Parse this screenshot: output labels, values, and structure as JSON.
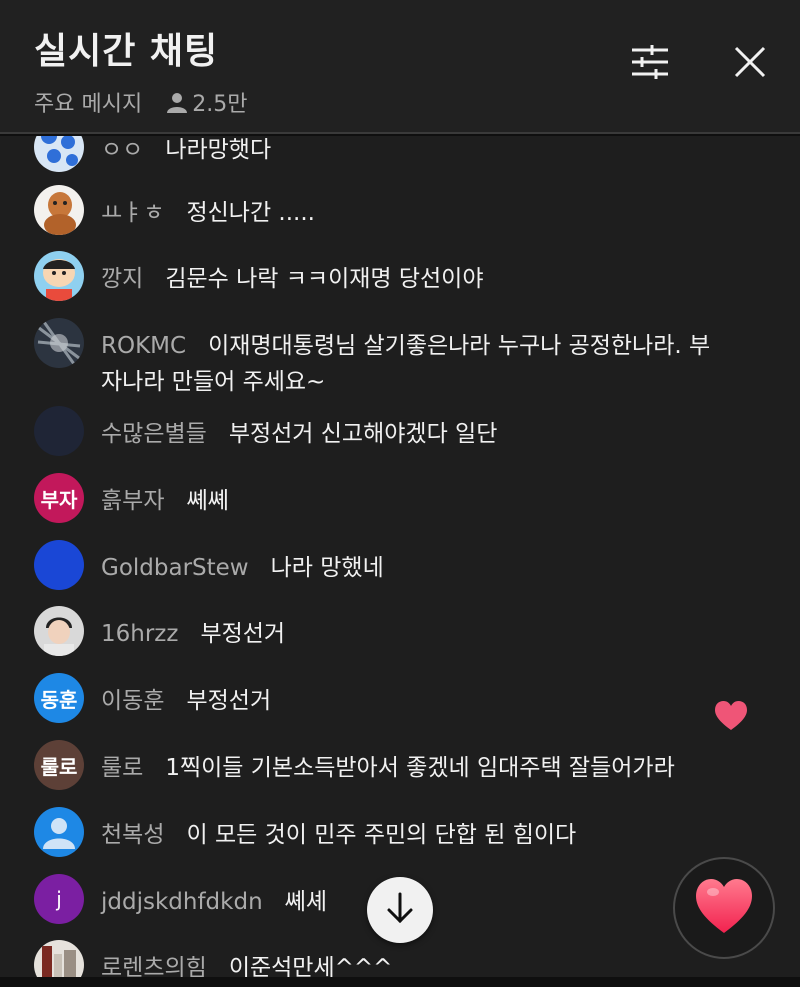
{
  "header": {
    "title": "실시간 채팅",
    "mode_label": "주요 메시지",
    "viewer_count": "2.5만",
    "filter_icon": "sliders-icon",
    "close_icon": "close-icon"
  },
  "messages": [
    {
      "author": "ㅇㅇ",
      "text": "나라망햇다",
      "avatar_text": ""
    },
    {
      "author": "ㅛㅑㅎ",
      "text": "정신나간 .....",
      "avatar_text": ""
    },
    {
      "author": "깡지",
      "text": "김문수 나락 ㅋㅋ이재명 당선이야",
      "avatar_text": ""
    },
    {
      "author": "ROKMC",
      "text": "이재명대통령님 살기좋은나라 누구나 공정한나라. 부자나라 만들어 주세요~",
      "avatar_text": ""
    },
    {
      "author": "수많은별들",
      "text": "부정선거 신고해야겠다 일단",
      "avatar_text": ""
    },
    {
      "author": "흙부자",
      "text": "쎼쎼",
      "avatar_text": "부자"
    },
    {
      "author": "GoldbarStew",
      "text": "나라 망했네",
      "avatar_text": ""
    },
    {
      "author": "16hrzz",
      "text": "부정선거",
      "avatar_text": ""
    },
    {
      "author": "이동훈",
      "text": "부정선거",
      "avatar_text": "동훈"
    },
    {
      "author": "룰로",
      "text": "1찍이들 기본소득받아서 좋겠네 임대주택 잘들어가라",
      "avatar_text": "룰로"
    },
    {
      "author": "천복성",
      "text": "이 모든 것이 민주 주민의 단합 된 힘이다",
      "avatar_text": ""
    },
    {
      "author": "jddjskdhfdkdn",
      "text": "쎼셰",
      "avatar_text": "j"
    },
    {
      "author": "로렌츠의힘",
      "text": "이준석만세^^^",
      "avatar_text": ""
    }
  ],
  "controls": {
    "scroll_down_icon": "arrow-down-icon",
    "reaction_icon": "heart-icon",
    "floating_reaction_icon": "heart-icon"
  },
  "colors": {
    "background": "#0f0f0f",
    "header": "#212121",
    "author": "#aaaaaa",
    "text": "#f1f1f1",
    "heart": "#ff4d6d"
  }
}
